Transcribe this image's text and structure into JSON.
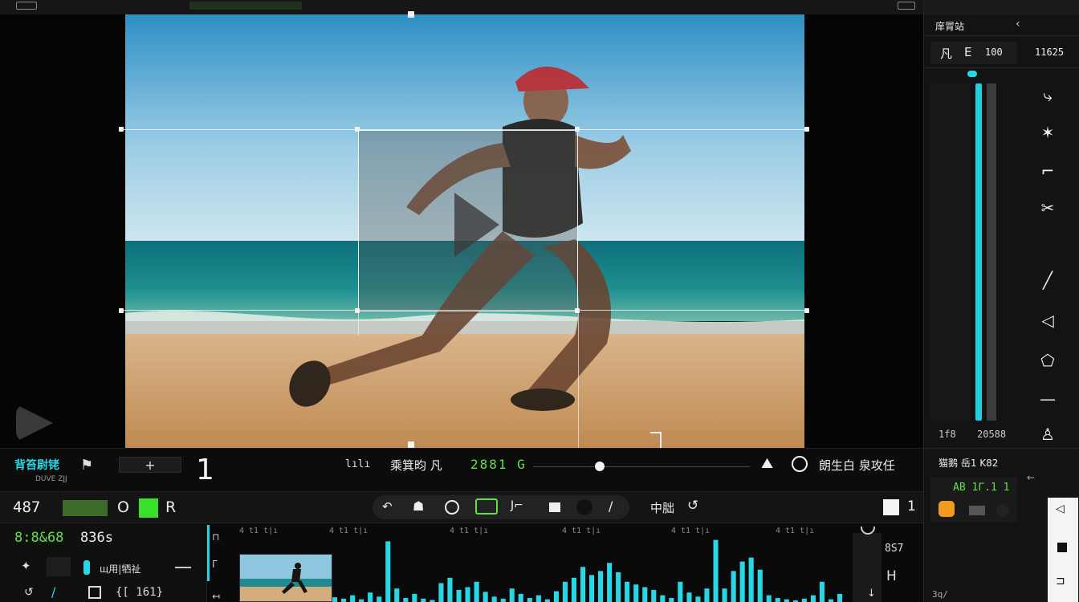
{
  "viewer": {
    "overlay_label": ""
  },
  "transport": {
    "project_name": "背笞尉铑",
    "project_sub": "DUVE ZJJ",
    "frame_number": "1",
    "mode_label": "lılı",
    "clip_label": "乘箕昀 凡",
    "timecode": "2881 G",
    "right_labels": "朗生白 泉攻任",
    "playhead_fraction": 0.28
  },
  "toolbar2": {
    "value": "487",
    "o_label": "O",
    "r_label": "R",
    "mode_text": "中朏",
    "count": "1"
  },
  "timeline": {
    "timecode": "8:8&68",
    "duration": "836s",
    "track_name": "щ用|牺祉",
    "track_value": "{[ 161}",
    "ruler_ticks": [
      "4 t1 t|ı",
      "4 t1 t|ı",
      "4 t1 t|ı",
      "4 t1 t|ı",
      "4 t1 t|ı",
      "4 t1 t|ı"
    ],
    "side_value": "8S7",
    "side_symbol": "H",
    "levels": [
      0.07,
      0.05,
      0.1,
      0.04,
      0.14,
      0.08,
      0.9,
      0.2,
      0.06,
      0.12,
      0.05,
      0.03,
      0.28,
      0.36,
      0.18,
      0.22,
      0.3,
      0.15,
      0.08,
      0.05,
      0.2,
      0.12,
      0.06,
      0.1,
      0.04,
      0.16,
      0.3,
      0.36,
      0.52,
      0.4,
      0.46,
      0.58,
      0.44,
      0.3,
      0.26,
      0.22,
      0.18,
      0.1,
      0.06,
      0.3,
      0.14,
      0.08,
      0.2,
      0.92,
      0.2,
      0.46,
      0.6,
      0.66,
      0.48,
      0.1,
      0.06,
      0.04,
      0.02,
      0.05,
      0.1,
      0.3,
      0.04,
      0.12
    ]
  },
  "right_panel": {
    "header_title": "庠冐站",
    "label_a": "凡",
    "label_b": "E",
    "value_a": "100",
    "value_b": "11625",
    "bottom_left": "1f8",
    "bottom_right": "20588",
    "section_title": "猫鹅 岳1 K82",
    "green_value": "AB 1Γ.1 1",
    "bottom_corner": "3q/",
    "level_fraction": 0.0
  },
  "colors": {
    "accent_cyan": "#27d7e6",
    "accent_green": "#62e04a",
    "accent_orange": "#f29a1f"
  }
}
